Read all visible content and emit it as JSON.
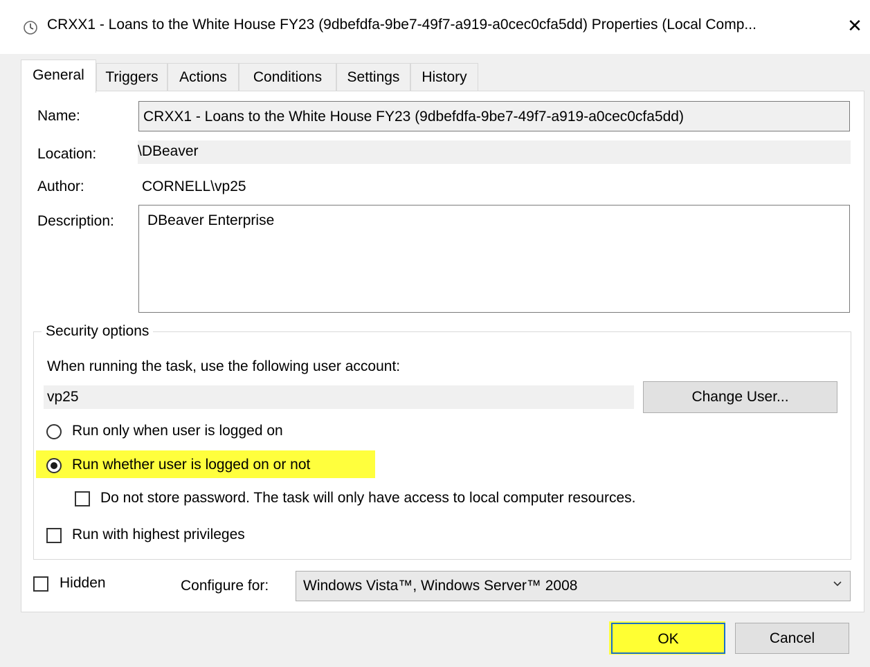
{
  "window": {
    "title": "CRXX1 - Loans to the White House FY23 (9dbefdfa-9be7-49f7-a919-a0cec0cfa5dd) Properties (Local Comp...",
    "close_glyph": "✕"
  },
  "tabs": [
    {
      "label": "General",
      "active": true
    },
    {
      "label": "Triggers"
    },
    {
      "label": "Actions"
    },
    {
      "label": "Conditions"
    },
    {
      "label": "Settings"
    },
    {
      "label": "History"
    }
  ],
  "general": {
    "name_label": "Name:",
    "name_value": "CRXX1 - Loans to the White House FY23 (9dbefdfa-9be7-49f7-a919-a0cec0cfa5dd)",
    "location_label": "Location:",
    "location_value": "\\DBeaver",
    "author_label": "Author:",
    "author_value": "CORNELL\\vp25",
    "description_label": "Description:",
    "description_value": "DBeaver Enterprise"
  },
  "security": {
    "legend": "Security options",
    "account_prompt": "When running the task, use the following user account:",
    "account_value": "vp25",
    "change_user_label": "Change User...",
    "radio_logged_on": "Run only when user is logged on",
    "radio_whether": "Run whether user is logged on or not",
    "checkbox_no_store": "Do not store password.  The task will only have access to local computer resources.",
    "checkbox_highest": "Run with highest privileges",
    "selected_radio": "whether",
    "highlight_color": "#ffff33"
  },
  "footer": {
    "hidden_label": "Hidden",
    "configure_label": "Configure for:",
    "configure_value": "Windows Vista™, Windows Server™ 2008",
    "ok_label": "OK",
    "cancel_label": "Cancel"
  },
  "icons": {
    "title_icon": "clock-icon",
    "dropdown_icon": "chevron-down-icon",
    "close_icon": "close-icon"
  }
}
